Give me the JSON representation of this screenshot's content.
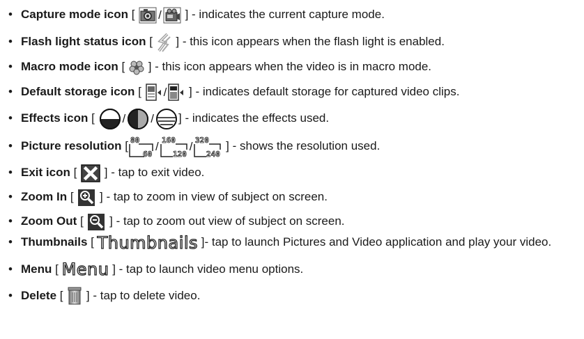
{
  "items": [
    {
      "title": "Capture mode icon",
      "open": " [ ",
      "close": " ]",
      "desc": " - indicates the current capture mode.",
      "icons": [
        "camera-icon",
        "video-camera-icon"
      ]
    },
    {
      "title": "Flash light status icon",
      "open": " [ ",
      "close": " ]",
      "desc": " - this icon appears when the flash light is enabled.",
      "icons": [
        "flash-icon"
      ]
    },
    {
      "title": "Macro mode icon",
      "open": " [ ",
      "close": " ]",
      "desc": " - this icon appears when the video is in macro mode.",
      "icons": [
        "macro-flower-icon"
      ]
    },
    {
      "title": "Default storage icon",
      "open": " [ ",
      "close": " ]",
      "desc": " - indicates default storage for captured video clips.",
      "icons": [
        "phone-memory-icon",
        "storage-card-icon"
      ]
    },
    {
      "title": "Effects icon",
      "open": " [ ",
      "close": "]",
      "desc": " - indicates the effects used.",
      "icons": [
        "effect-normal-icon",
        "effect-grayscale-icon",
        "effect-sepia-icon"
      ]
    },
    {
      "title": "Picture resolution",
      "open": " [",
      "close": " ]",
      "desc": " - shows the resolution used.",
      "icons": [
        "resolution-80x60-icon",
        "resolution-160x120-icon",
        "resolution-320x240-icon"
      ],
      "resolutions": [
        {
          "w": "80",
          "h": "60"
        },
        {
          "w": "160",
          "h": "120"
        },
        {
          "w": "320",
          "h": "240"
        }
      ]
    },
    {
      "title": "Exit icon",
      "open": " [ ",
      "close": " ]",
      "desc": " - tap to exit video.",
      "icons": [
        "close-icon"
      ]
    },
    {
      "title": "Zoom In",
      "open": " [ ",
      "close": " ]",
      "desc": " - tap to zoom in view of subject on screen.",
      "icons": [
        "zoom-in-icon"
      ]
    },
    {
      "title": "Zoom Out",
      "open": " [ ",
      "close": " ]",
      "desc": " - tap to zoom out view of subject on screen.",
      "icons": [
        "zoom-out-icon"
      ]
    },
    {
      "title": "Thumbnails",
      "open": " [ ",
      "close": " ]",
      "desc": "- tap to launch Pictures and Video application and play your video.",
      "word_icon": "Thumbnails"
    },
    {
      "title": "Menu",
      "open": " [ ",
      "close": " ]",
      "desc": " - tap to launch video menu options.",
      "word_icon": "Menu"
    },
    {
      "title": "Delete",
      "open": " [ ",
      "close": " ]",
      "desc": " - tap to delete video.",
      "icons": [
        "trash-icon"
      ]
    }
  ],
  "separator": "/"
}
